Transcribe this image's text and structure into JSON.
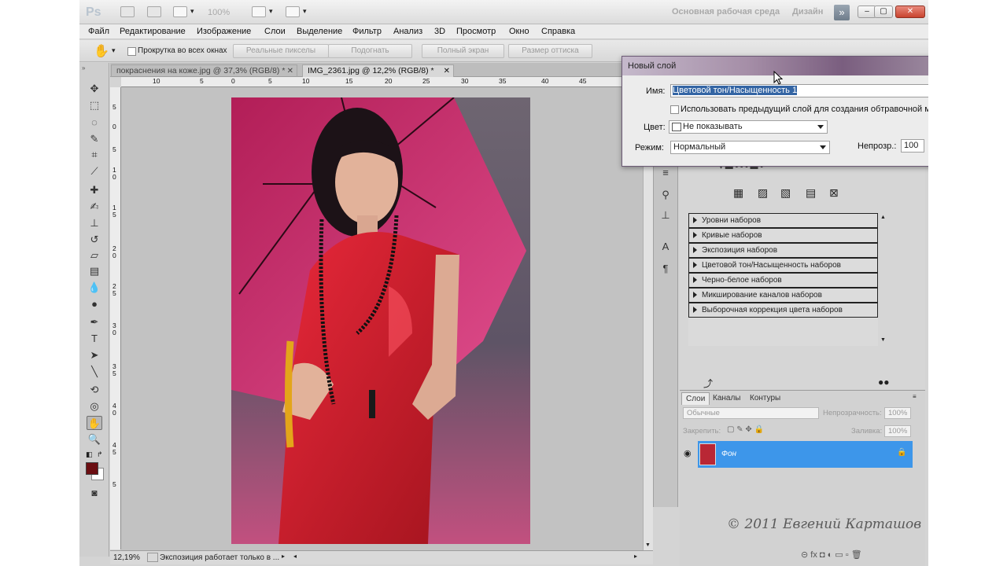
{
  "app": {
    "logo": "Ps",
    "zoom_value": "100%",
    "workspaces": [
      "Основная рабочая среда",
      "Дизайн"
    ],
    "window_buttons": [
      "–",
      "▢",
      "✕"
    ]
  },
  "menu": [
    "Файл",
    "Редактирование",
    "Изображение",
    "Слои",
    "Выделение",
    "Фильтр",
    "Анализ",
    "3D",
    "Просмотр",
    "Окно",
    "Справка"
  ],
  "options": {
    "scroll_all_label": "Прокрутка во всех окнах",
    "buttons": [
      "Реальные пикселы",
      "Подогнать",
      "Полный экран",
      "Размер оттиска"
    ]
  },
  "tabs": [
    {
      "label": "покраснения на коже.jpg @ 37,3% (RGB/8) *",
      "close": "✕"
    },
    {
      "label": "IMG_2361.jpg @ 12,2% (RGB/8) *",
      "close": "✕"
    }
  ],
  "ruler_top": [
    "10",
    "5",
    "0",
    "5",
    "10",
    "15",
    "20",
    "25",
    "30",
    "35",
    "40",
    "45"
  ],
  "ruler_left": [
    "5",
    "0",
    "5",
    "1",
    "0",
    "1",
    "5",
    "2",
    "0",
    "2",
    "5",
    "3",
    "0",
    "3",
    "5",
    "4",
    "0",
    "4",
    "5",
    "5"
  ],
  "status": {
    "zoom": "12,19%",
    "message": "Экспозиция работает только в ..."
  },
  "dialog": {
    "title": "Новый слой",
    "name_label": "Имя:",
    "name_value": "Цветовой тон/Насыщенность 1",
    "use_previous_label": "Использовать предыдущий слой для создания обтравочной м",
    "color_label": "Цвет:",
    "color_value": "Не показывать",
    "mode_label": "Режим:",
    "mode_value": "Нормальный",
    "opacity_label": "Непрозр.:",
    "opacity_value": "100"
  },
  "adjustments": {
    "presets": [
      "Уровни наборов",
      "Кривые наборов",
      "Экспозиция наборов",
      "Цветовой тон/Насыщенность наборов",
      "Черно-белое наборов",
      "Микширование каналов наборов",
      "Выборочная коррекция цвета наборов"
    ]
  },
  "layers_panel": {
    "tabs": [
      "Слои",
      "Каналы",
      "Контуры"
    ],
    "blend_mode": "Обычные",
    "opacity_label": "Непрозрачность:",
    "opacity_value": "100%",
    "lock_label": "Закрепить:",
    "fill_label": "Заливка:",
    "fill_value": "100%",
    "layer_name": "Фон",
    "watermark": "© 2011 Евгений Карташов"
  },
  "colors": {
    "foreground": "#6b0e12",
    "background": "#ffffff",
    "selected_layer": "#3d96ea",
    "dialog_selection": "#3465a4"
  }
}
